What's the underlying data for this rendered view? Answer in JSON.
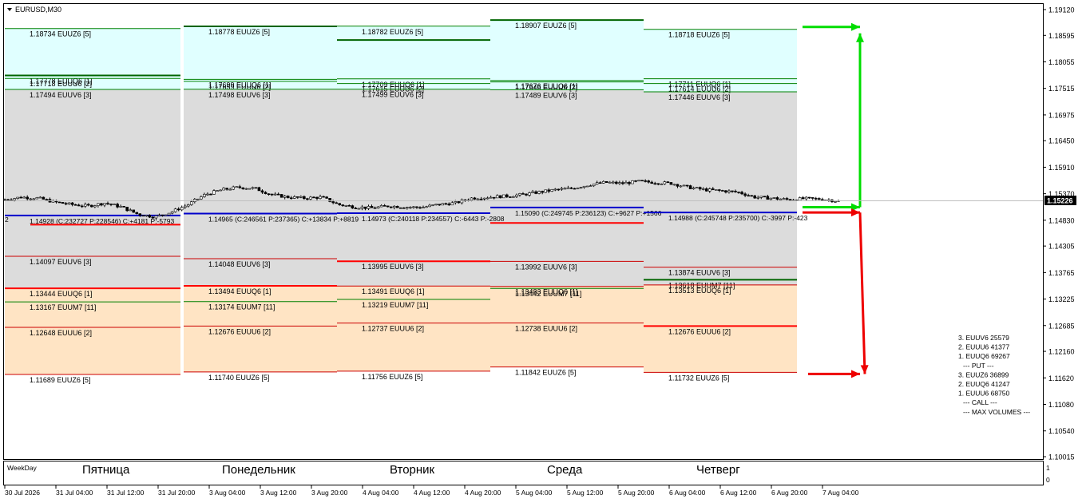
{
  "window": {
    "symbol_title": "EURUSD,M30"
  },
  "price_axis": {
    "labels": [
      "1.19120",
      "1.18595",
      "1.18055",
      "1.17515",
      "1.16975",
      "1.16450",
      "1.15910",
      "1.15370",
      "1.14830",
      "1.14305",
      "1.13765",
      "1.13225",
      "1.12685",
      "1.12160",
      "1.11620",
      "1.11080",
      "1.10540",
      "1.10015"
    ],
    "current_price": "1.15226",
    "left_edge_label": "2"
  },
  "subwindow": {
    "name": "WeekDay",
    "scale_labels": [
      "1",
      "0"
    ],
    "days": [
      "Пятница",
      "Понедельник",
      "Вторник",
      "Среда",
      "Четверг"
    ]
  },
  "time_axis": {
    "labels": [
      "30 Jul 2026",
      "31 Jul 04:00",
      "31 Jul 12:00",
      "31 Jul 20:00",
      "3 Aug 04:00",
      "3 Aug 12:00",
      "3 Aug 20:00",
      "4 Aug 04:00",
      "4 Aug 12:00",
      "4 Aug 20:00",
      "5 Aug 04:00",
      "5 Aug 12:00",
      "5 Aug 20:00",
      "6 Aug 04:00",
      "6 Aug 12:00",
      "6 Aug 20:00",
      "7 Aug 04:00"
    ]
  },
  "colors": {
    "call_zone": "#e0ffff",
    "mid_zone": "#dcdcdc",
    "put_zone": "#ffe4c4",
    "call_line": "#008000",
    "put_line": "#cc0000",
    "max_call": "#006400",
    "max_put": "#ff0000",
    "pivot_line": "#0000cc",
    "arrow_green": "#00dd00",
    "arrow_red": "#ee0000"
  },
  "legend": {
    "lines": [
      "3. EUUV6 25579",
      "2. EUUU6 41377",
      "1. EUUQ6 69267",
      "--- PUT ---",
      "3. EUUZ6 36899",
      "2. EUUQ6 41247",
      "1. EUUU6 68750",
      "--- CALL ---",
      "--- MAX VOLUMES ---"
    ]
  },
  "chart_data": {
    "type": "candlestick",
    "title": "EURUSD,M30",
    "xlabel": "",
    "ylabel": "",
    "ylim": [
      1.10015,
      1.1912
    ],
    "y_ticks": [
      1.1912,
      1.18595,
      1.18055,
      1.17515,
      1.16975,
      1.1645,
      1.1591,
      1.1537,
      1.1483,
      1.14305,
      1.13765,
      1.13225,
      1.12685,
      1.1216,
      1.1162,
      1.1108,
      1.1054,
      1.10015
    ],
    "x_ticks": [
      "30 Jul 2026",
      "31 Jul 04:00",
      "31 Jul 12:00",
      "31 Jul 20:00",
      "3 Aug 04:00",
      "3 Aug 12:00",
      "3 Aug 20:00",
      "4 Aug 04:00",
      "4 Aug 12:00",
      "4 Aug 20:00",
      "5 Aug 04:00",
      "5 Aug 12:00",
      "5 Aug 20:00",
      "6 Aug 04:00",
      "6 Aug 12:00",
      "6 Aug 20:00",
      "7 Aug 04:00"
    ],
    "current_price": 1.15226,
    "price_path": [
      1.1525,
      1.153,
      1.1528,
      1.152,
      1.1515,
      1.1512,
      1.1518,
      1.151,
      1.1495,
      1.149,
      1.15,
      1.1515,
      1.1535,
      1.1545,
      1.155,
      1.1548,
      1.1535,
      1.153,
      1.1528,
      1.153,
      1.1515,
      1.151,
      1.1508,
      1.1512,
      1.151,
      1.1509,
      1.1515,
      1.1518,
      1.1528,
      1.153,
      1.1532,
      1.1535,
      1.154,
      1.1545,
      1.1548,
      1.1555,
      1.156,
      1.1558,
      1.1562,
      1.156,
      1.1558,
      1.155,
      1.1545,
      1.1543,
      1.154,
      1.153,
      1.1528,
      1.1525,
      1.1527,
      1.1526,
      1.1522
    ],
    "days": [
      {
        "name": "Пятница",
        "levels": [
          {
            "label": "1.18734 EUUZ6 [5]",
            "kind": "call",
            "price": 1.18734,
            "max": false
          },
          {
            "label": "1.17778 EUUQ6 [1]",
            "kind": "call",
            "price": 1.17778,
            "max": true
          },
          {
            "label": "1.17718 EUUU6 [2]",
            "kind": "call",
            "price": 1.17718,
            "max": false
          },
          {
            "label": "1.17494 EUUV6 [3]",
            "kind": "call",
            "price": 1.17494,
            "max": false
          },
          {
            "label": "1.14928 (C:232727 P:228546) C:+4181 P:-5793",
            "kind": "pivot",
            "price": 1.14928,
            "max": false
          },
          {
            "label": "",
            "kind": "put",
            "price": 1.1474,
            "max": true
          },
          {
            "label": "1.14097 EUUV6 [3]",
            "kind": "put",
            "price": 1.14097,
            "max": false
          },
          {
            "label": "1.13444 EUUQ6 [1]",
            "kind": "put",
            "price": 1.13444,
            "max": true
          },
          {
            "label": "1.13167 EUUM7 [11]",
            "kind": "call",
            "price": 1.13167,
            "max": false
          },
          {
            "label": "1.12648 EUUU6 [2]",
            "kind": "put",
            "price": 1.12648,
            "max": false
          },
          {
            "label": "1.11689 EUUZ6 [5]",
            "kind": "put",
            "price": 1.11689,
            "max": false
          }
        ]
      },
      {
        "name": "Понедельник",
        "levels": [
          {
            "label": "1.18778 EUUZ6 [5]",
            "kind": "call",
            "price": 1.18778,
            "max": true
          },
          {
            "label": "1.17699 EUUQ6 [1]",
            "kind": "call",
            "price": 1.17699,
            "max": false
          },
          {
            "label": "1.17659 EUUU6 [2]",
            "kind": "call",
            "price": 1.17659,
            "max": false
          },
          {
            "label": "1.17498 EUUV6 [3]",
            "kind": "call",
            "price": 1.17498,
            "max": false
          },
          {
            "label": "1.14965 (C:246561 P:237365) C:+13834 P:+8819",
            "kind": "pivot",
            "price": 1.14965,
            "max": false
          },
          {
            "label": "1.14048 EUUV6 [3]",
            "kind": "put",
            "price": 1.14048,
            "max": false
          },
          {
            "label": "1.13494 EUUQ6 [1]",
            "kind": "put",
            "price": 1.13494,
            "max": true
          },
          {
            "label": "1.13174 EUUM7 [11]",
            "kind": "call",
            "price": 1.13174,
            "max": false
          },
          {
            "label": "1.12676 EUUU6 [2]",
            "kind": "put",
            "price": 1.12676,
            "max": false
          },
          {
            "label": "1.11740 EUUZ6 [5]",
            "kind": "put",
            "price": 1.1174,
            "max": false
          }
        ]
      },
      {
        "name": "Вторник",
        "levels": [
          {
            "label": "1.18782 EUUZ6 [5]",
            "kind": "call",
            "price": 1.18782,
            "max": false
          },
          {
            "label": "",
            "kind": "call",
            "price": 1.185,
            "max": true
          },
          {
            "label": "1.17709 EUUQ6 [1]",
            "kind": "call",
            "price": 1.17709,
            "max": false
          },
          {
            "label": "1.17615 EUUU6 [2]",
            "kind": "call",
            "price": 1.17615,
            "max": false
          },
          {
            "label": "1.17499 EUUV6 [3]",
            "kind": "call",
            "price": 1.17499,
            "max": false
          },
          {
            "label": "1.14973 (C:240118 P:234557) C:-6443 P:-2808",
            "kind": "pivot",
            "price": 1.14973,
            "max": false
          },
          {
            "label": "1.13995 EUUV6 [3]",
            "kind": "put",
            "price": 1.13995,
            "max": true
          },
          {
            "label": "1.13491 EUUQ6 [1]",
            "kind": "put",
            "price": 1.13491,
            "max": false
          },
          {
            "label": "1.13219 EUUM7 [11]",
            "kind": "call",
            "price": 1.13219,
            "max": false
          },
          {
            "label": "1.12737 EUUU6 [2]",
            "kind": "put",
            "price": 1.12737,
            "max": false
          },
          {
            "label": "1.11756 EUUZ6 [5]",
            "kind": "put",
            "price": 1.11756,
            "max": false
          }
        ]
      },
      {
        "name": "Среда",
        "levels": [
          {
            "label": "1.18907 EUUZ6 [5]",
            "kind": "call",
            "price": 1.18907,
            "max": true
          },
          {
            "label": "1.17676 EUUQ6 [1]",
            "kind": "call",
            "price": 1.17676,
            "max": false
          },
          {
            "label": "1.17646 EUUU6 [2]",
            "kind": "call",
            "price": 1.17646,
            "max": false
          },
          {
            "label": "1.17489 EUUV6 [3]",
            "kind": "call",
            "price": 1.17489,
            "max": false
          },
          {
            "label": "1.15090 (C:249745 P:236123) C:+9627 P:+1566",
            "kind": "pivot",
            "price": 1.1509,
            "max": false
          },
          {
            "label": "",
            "kind": "put",
            "price": 1.14775,
            "max": true
          },
          {
            "label": "1.13992 EUUV6 [3]",
            "kind": "put",
            "price": 1.13992,
            "max": false
          },
          {
            "label": "1.13483 EUUQ6 [1]",
            "kind": "put",
            "price": 1.13483,
            "max": false
          },
          {
            "label": "1.13442 EUUM7 [11]",
            "kind": "call",
            "price": 1.13442,
            "max": false
          },
          {
            "label": "1.12738 EUUU6 [2]",
            "kind": "put",
            "price": 1.12738,
            "max": false
          },
          {
            "label": "1.11842 EUUZ6 [5]",
            "kind": "put",
            "price": 1.11842,
            "max": false
          }
        ]
      },
      {
        "name": "Четверг",
        "levels": [
          {
            "label": "1.18718 EUUZ6 [5]",
            "kind": "call",
            "price": 1.18718,
            "max": false
          },
          {
            "label": "1.17711 EUUQ6 [1]",
            "kind": "call",
            "price": 1.17711,
            "max": false
          },
          {
            "label": "1.17614 EUUU6 [2]",
            "kind": "call",
            "price": 1.17614,
            "max": false
          },
          {
            "label": "1.17446 EUUV6 [3]",
            "kind": "call",
            "price": 1.17446,
            "max": false
          },
          {
            "label": "1.14988 (C:245748 P:235700) C:-3997 P:-423",
            "kind": "pivot",
            "price": 1.14988,
            "max": false
          },
          {
            "label": "1.13874 EUUV6 [3]",
            "kind": "put",
            "price": 1.13874,
            "max": false
          },
          {
            "label": "1.13618 EUUM7 [11]",
            "kind": "call",
            "price": 1.13618,
            "max": true
          },
          {
            "label": "1.13513 EUUQ6 [1]",
            "kind": "put",
            "price": 1.13513,
            "max": false
          },
          {
            "label": "1.12676 EUUU6 [2]",
            "kind": "put",
            "price": 1.12676,
            "max": true
          },
          {
            "label": "1.11732 EUUZ6 [5]",
            "kind": "put",
            "price": 1.11732,
            "max": false
          }
        ]
      }
    ],
    "projection": {
      "call_target": 1.18718,
      "put_target": 1.11732,
      "pivot": 1.14988,
      "current": 1.15226
    }
  }
}
